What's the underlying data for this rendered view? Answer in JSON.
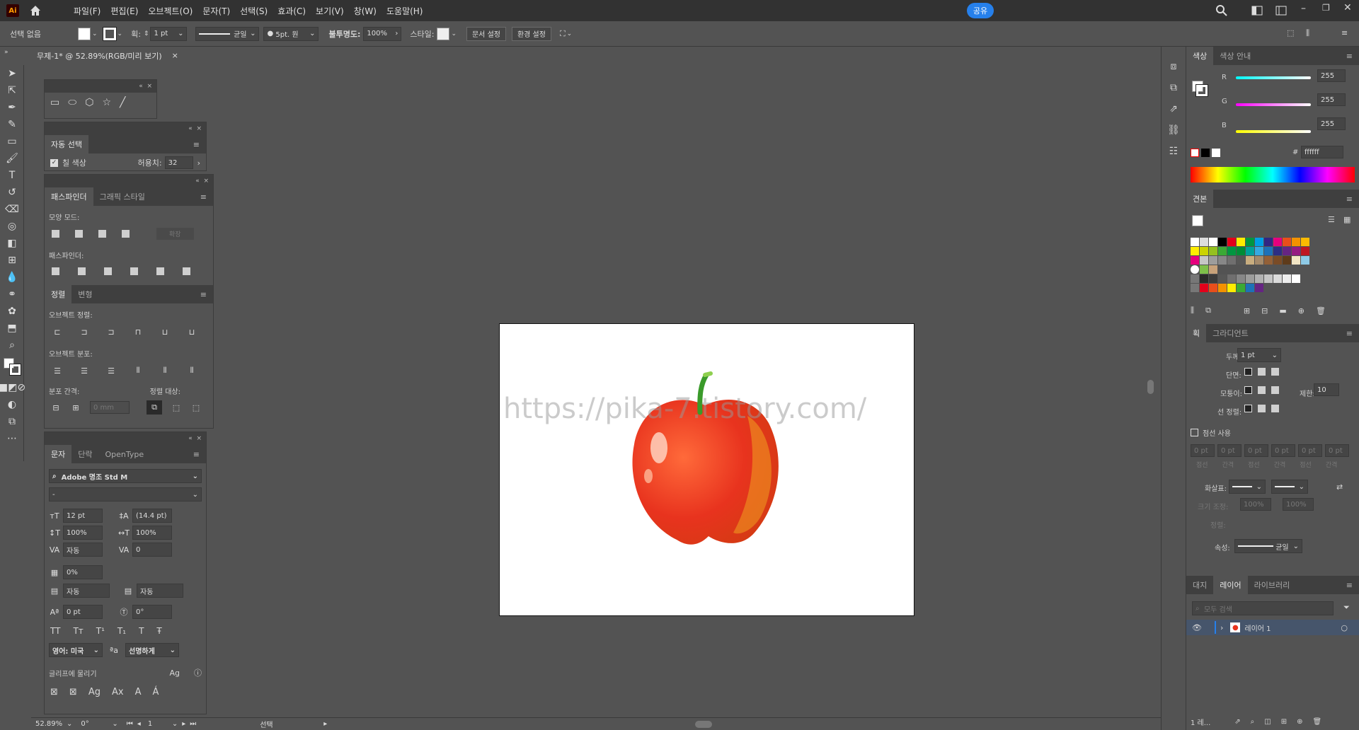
{
  "menubar": {
    "logo": "Ai",
    "items": [
      "파일(F)",
      "편집(E)",
      "오브젝트(O)",
      "문자(T)",
      "선택(S)",
      "효과(C)",
      "보기(V)",
      "창(W)",
      "도움말(H)"
    ],
    "share": "공유"
  },
  "control": {
    "selection": "선택 없음",
    "stroke_label": "획:",
    "stroke_val": "1 pt",
    "stroke_style": "균일",
    "brush": "5pt. 원",
    "opacity_label": "불투명도:",
    "opacity": "100%",
    "style_label": "스타일:",
    "doc_setup": "문서 설정",
    "prefs": "환경 설정"
  },
  "doc_tab": {
    "title": "무제-1* @ 52.89%(RGB/미리 보기)",
    "close": "×"
  },
  "canvas": {
    "watermark": "https://pika-7.tistory.com/"
  },
  "auto_select": {
    "title": "자동 선택",
    "fill_color": "칠 색상",
    "tolerance_label": "허용치:",
    "tolerance": "32"
  },
  "pathfinder": {
    "tabs": [
      "패스파인더",
      "그래픽 스타일"
    ],
    "shape_modes": "모양 모드:",
    "expand": "확장",
    "pathfinders": "패스파인더:"
  },
  "align": {
    "tabs": [
      "정렬",
      "변형"
    ],
    "align_objects": "오브젝트 정렬:",
    "distribute_objects": "오브젝트 분포:",
    "distribute_spacing": "분포 간격:",
    "align_to": "정렬 대상:",
    "spacing_val": "0 mm"
  },
  "character": {
    "tabs": [
      "문자",
      "단락",
      "OpenType"
    ],
    "font": "Adobe 명조 Std M",
    "style": "-",
    "size": "12 pt",
    "leading": "(14.4 pt)",
    "vscale": "100%",
    "hscale": "100%",
    "kerning": "자동",
    "tracking": "0",
    "tsume": "0%",
    "aki_left": "자동",
    "aki_right": "자동",
    "baseline": "0 pt",
    "rotation": "0°",
    "language": "영어: 미국",
    "aa": "선명하게",
    "snap": "글리프에 물리기"
  },
  "color": {
    "tabs": [
      "색상",
      "색상 안내"
    ],
    "r": "255",
    "g": "255",
    "b": "255",
    "hex": "ffffff"
  },
  "swatches": {
    "title": "견본"
  },
  "stroke": {
    "tabs": [
      "획",
      "그라디언트"
    ],
    "weight_label": "두께:",
    "weight": "1 pt",
    "cap_label": "단면:",
    "corner_label": "모퉁이:",
    "limit_label": "제한:",
    "limit": "10",
    "align_label": "선 정렬:",
    "dashed": "점선 사용",
    "dash_vals": [
      "0 pt",
      "0 pt",
      "0 pt",
      "0 pt",
      "0 pt",
      "0 pt"
    ],
    "dash_labels": [
      "점선",
      "간격",
      "점선",
      "간격",
      "점선",
      "간격"
    ],
    "arrow_label": "화살표:",
    "scale_label": "크기 조정:",
    "scale1": "100%",
    "scale2": "100%",
    "align2_label": "정렬:",
    "profile_label": "속성:",
    "profile": "균일"
  },
  "layers": {
    "tabs": [
      "대지",
      "레이어",
      "라이브러리"
    ],
    "search": "모두 검색",
    "layer_name": "레이어 1",
    "count": "1 레..."
  },
  "status": {
    "zoom": "52.89%",
    "rotate": "0°",
    "page": "1",
    "tool": "선택"
  },
  "colors": {
    "accent": "#2680eb",
    "apple": "#e8331e",
    "stem": "#3a9a2a"
  }
}
